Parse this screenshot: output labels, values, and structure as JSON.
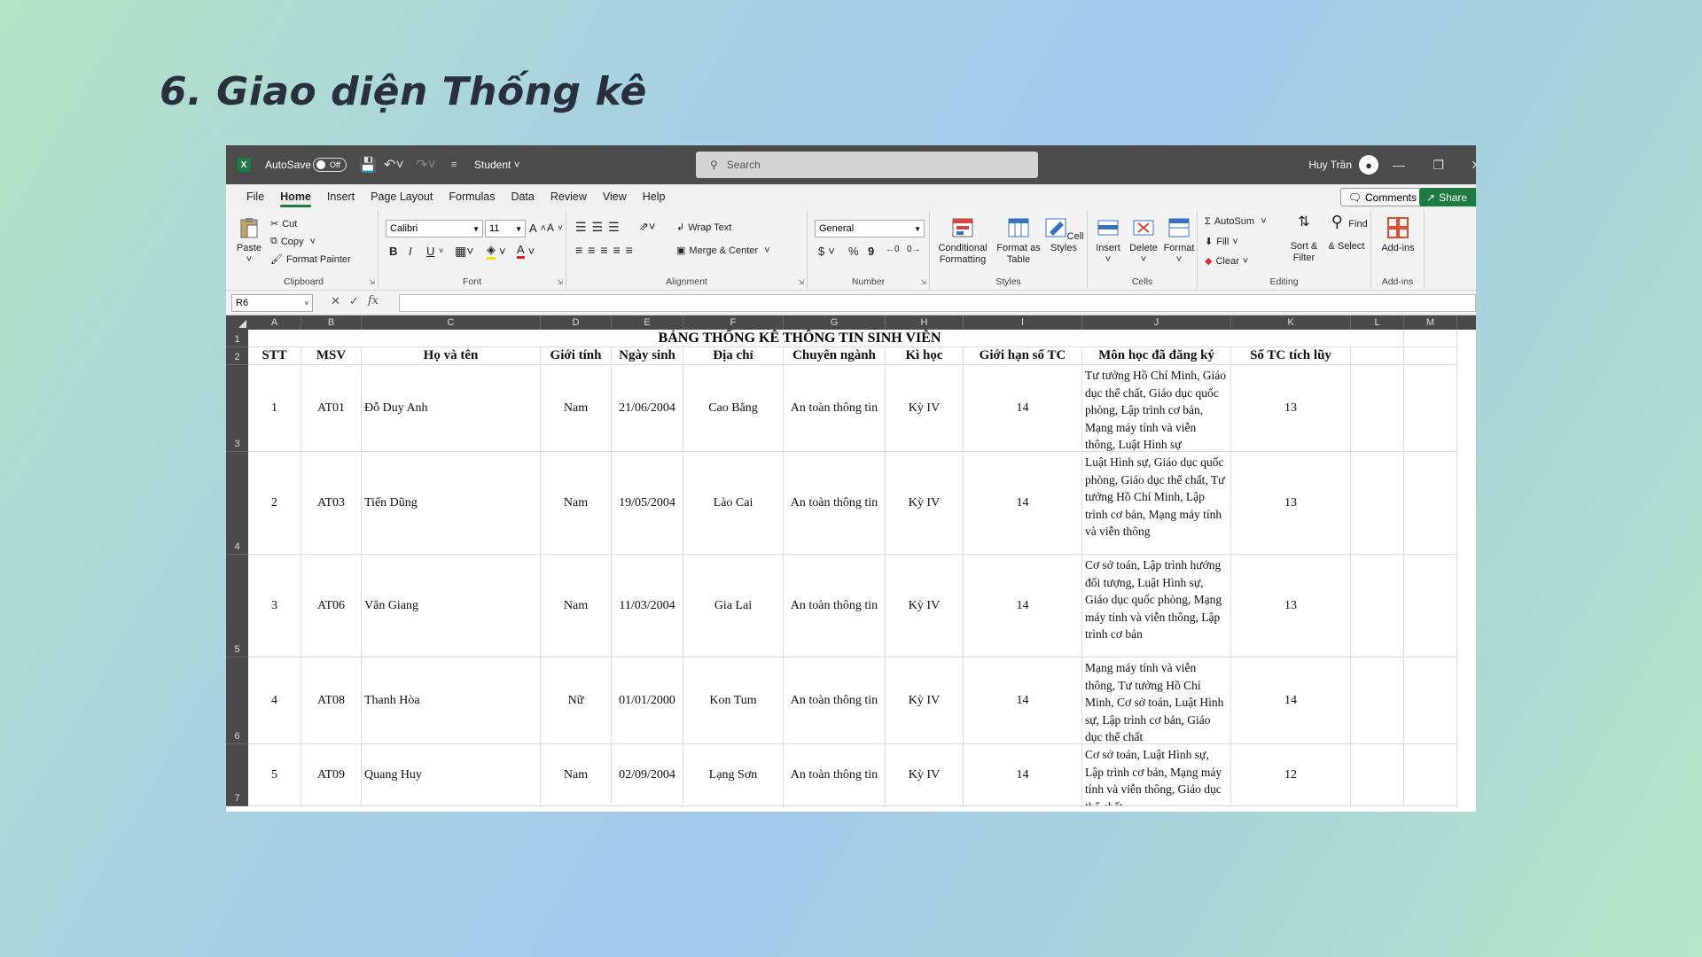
{
  "slide": {
    "title": "6. Giao diện Thống kê"
  },
  "window": {
    "autosave_label": "AutoSave",
    "autosave_state": "Off",
    "file_name": "Student",
    "search_placeholder": "Search",
    "user_name": "Huy Trần",
    "app_icon": "X"
  },
  "menu": {
    "items": [
      "File",
      "Home",
      "Insert",
      "Page Layout",
      "Formulas",
      "Data",
      "Review",
      "View",
      "Help"
    ],
    "active": "Home",
    "comments_label": "Comments",
    "share_label": "Share"
  },
  "ribbon": {
    "clipboard": {
      "paste": "Paste",
      "cut": "Cut",
      "copy": "Copy",
      "format_painter": "Format Painter",
      "label": "Clipboard"
    },
    "font": {
      "name": "Calibri",
      "size": "11",
      "bold": "B",
      "italic": "I",
      "underline": "U",
      "label": "Font"
    },
    "alignment": {
      "wrap": "Wrap Text",
      "merge": "Merge & Center",
      "label": "Alignment"
    },
    "number": {
      "format": "General",
      "currency": "$",
      "percent": "%",
      "comma": "9",
      "label": "Number"
    },
    "styles": {
      "conditional": "Conditional Formatting",
      "format_table": "Format as Table",
      "cell_styles": "Cell Styles",
      "label": "Styles"
    },
    "cells": {
      "insert": "Insert",
      "delete": "Delete",
      "format": "Format",
      "label": "Cells"
    },
    "editing": {
      "autosum": "AutoSum",
      "fill": "Fill",
      "clear": "Clear",
      "sort": "Sort & Filter",
      "find": "Find & Select",
      "label": "Editing"
    },
    "addins": {
      "addins": "Add-ins",
      "label": "Add-ins"
    }
  },
  "formula_bar": {
    "name_box": "R6",
    "fx": "fx",
    "value": ""
  },
  "sheet": {
    "columns": [
      "A",
      "B",
      "C",
      "D",
      "E",
      "F",
      "G",
      "H",
      "I",
      "J",
      "K",
      "L",
      "M"
    ],
    "row_numbers": [
      "1",
      "2",
      "3",
      "4",
      "5",
      "6",
      "7"
    ],
    "title": "BẢNG THỐNG KÊ THÔNG TIN SINH VIÊN",
    "headers": [
      "STT",
      "MSV",
      "Họ và tên",
      "Giới tính",
      "Ngày sinh",
      "Địa chỉ",
      "Chuyên ngành",
      "Kì học",
      "Giới hạn số TC",
      "Môn học đã đăng ký",
      "Số TC tích lũy"
    ],
    "rows": [
      [
        "1",
        "AT01",
        "Đỗ Duy Anh",
        "Nam",
        "21/06/2004",
        "Cao Bằng",
        "An toàn thông tin",
        "Kỳ IV",
        "14",
        "Tư tưởng Hồ Chí Minh, Giáo dục thể chất, Giáo dục quốc phòng, Lập trình cơ bản, Mạng máy tính và viễn thông, Luật Hình sự",
        "13"
      ],
      [
        "2",
        "AT03",
        "Tiến Dũng",
        "Nam",
        "19/05/2004",
        "Lào Cai",
        "An toàn thông tin",
        "Kỳ IV",
        "14",
        "Luật Hình sự, Giáo dục quốc phòng, Giáo dục thể chất, Tư tưởng Hồ Chí Minh, Lập trình cơ bản, Mạng máy tính và viễn thông",
        "13"
      ],
      [
        "3",
        "AT06",
        "Văn Giang",
        "Nam",
        "11/03/2004",
        "Gia Lai",
        "An toàn thông tin",
        "Kỳ IV",
        "14",
        "Cơ sở toán, Lập trình hướng đối tượng, Luật Hình sự, Giáo dục quốc phòng, Mạng máy tính và viễn thông, Lập trình cơ bản",
        "13"
      ],
      [
        "4",
        "AT08",
        "Thanh Hòa",
        "Nữ",
        "01/01/2000",
        "Kon Tum",
        "An toàn thông tin",
        "Kỳ IV",
        "14",
        "Mạng máy tính và viễn thông, Tư tưởng Hồ Chí Minh, Cơ sở toán, Luật Hình sự, Lập trình cơ bản, Giáo dục thể chất",
        "14"
      ],
      [
        "5",
        "AT09",
        "Quang Huy",
        "Nam",
        "02/09/2004",
        "Lạng Sơn",
        "An toàn thông tin",
        "Kỳ IV",
        "14",
        "Cơ sở toán, Luật Hình sự, Lập trình cơ bản, Mạng máy tính và viễn thông, Giáo dục thể chất",
        "12"
      ]
    ]
  },
  "colors": {
    "excel_green": "#1d7a43",
    "titlebar": "#4b4b4b",
    "header_dark": "#4a4a4a"
  },
  "icons": [
    "excel-logo-icon",
    "toggle-icon",
    "save-icon",
    "undo-icon",
    "redo-icon",
    "customize-icon",
    "search-icon",
    "avatar-icon",
    "minimize-icon",
    "restore-icon",
    "close-icon",
    "comment-icon",
    "share-icon"
  ]
}
